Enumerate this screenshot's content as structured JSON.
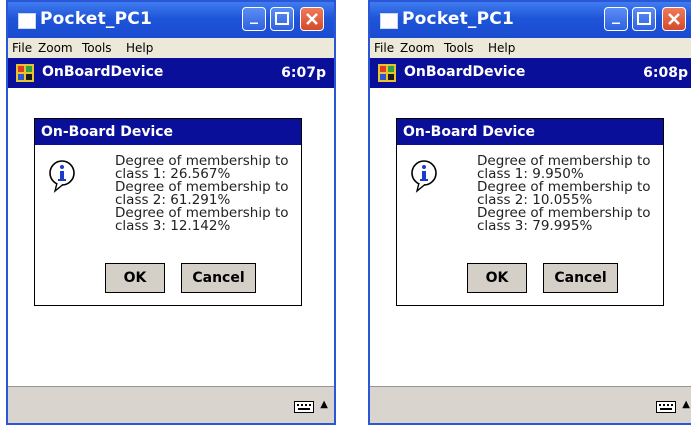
{
  "devices": [
    {
      "window_title": "Pocket_PC1",
      "menu": [
        "File",
        "Zoom",
        "Tools",
        "Help"
      ],
      "app_name": "OnBoardDevice",
      "clock": "6:07p",
      "dialog": {
        "title": "On-Board Device",
        "lines": [
          "Degree of membership to",
          "class 1: 26.567%",
          "Degree of membership to",
          "class 2: 61.291%",
          "Degree of membership to",
          "class 3: 12.142%"
        ],
        "ok_label": "OK",
        "cancel_label": "Cancel"
      }
    },
    {
      "window_title": "Pocket_PC1",
      "menu": [
        "File",
        "Zoom",
        "Tools",
        "Help"
      ],
      "app_name": "OnBoardDevice",
      "clock": "6:08p",
      "dialog": {
        "title": "On-Board Device",
        "lines": [
          "Degree of membership to",
          "class 1: 9.950%",
          "Degree of membership to",
          "class 2: 10.055%",
          "Degree of membership to",
          "class 3: 79.995%"
        ],
        "ok_label": "OK",
        "cancel_label": "Cancel"
      }
    }
  ],
  "colors": {
    "title_bar": "#1e55d8",
    "app_bar": "#0a0f9a",
    "menu_bg": "#ece9d8",
    "button_bg": "#d4d0c8"
  }
}
